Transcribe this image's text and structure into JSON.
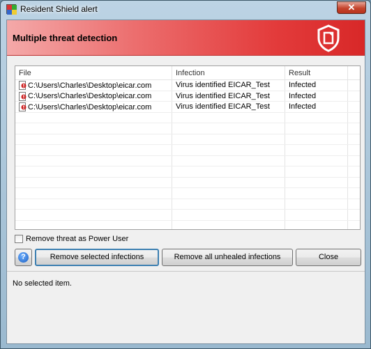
{
  "window": {
    "title": "Resident Shield alert",
    "close_glyph": "✕"
  },
  "banner": {
    "title": "Multiple threat detection",
    "accent": "#e33b3b"
  },
  "table": {
    "columns": [
      "File",
      "Infection",
      "Result"
    ],
    "rows": [
      {
        "file": "C:\\Users\\Charles\\Desktop\\eicar.com",
        "infection": "Virus identified EICAR_Test",
        "result": "Infected"
      },
      {
        "file": "C:\\Users\\Charles\\Desktop\\eicar.com",
        "infection": "Virus identified EICAR_Test",
        "result": "Infected"
      },
      {
        "file": "C:\\Users\\Charles\\Desktop\\eicar.com",
        "infection": "Virus identified EICAR_Test",
        "result": "Infected"
      }
    ]
  },
  "options": {
    "power_user_label": "Remove threat as Power User",
    "power_user_checked": false
  },
  "buttons": {
    "help_glyph": "?",
    "remove_selected": "Remove selected infections",
    "remove_all": "Remove all unhealed infections",
    "close": "Close"
  },
  "status": {
    "text": "No selected item."
  }
}
